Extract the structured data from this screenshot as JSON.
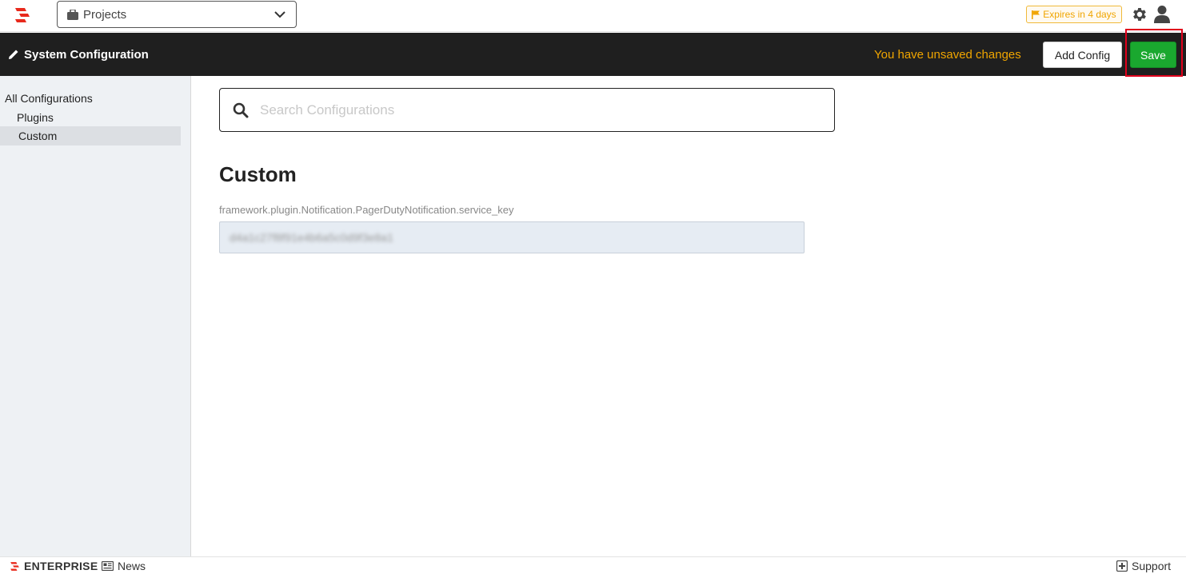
{
  "topbar": {
    "project_select_label": "Projects",
    "expires_badge": "Expires in 4 days",
    "colors": {
      "logo": "#e8291c",
      "badge": "#f0a500"
    }
  },
  "header": {
    "title": "System Configuration",
    "unsaved_text": "You have unsaved changes",
    "add_config_label": "Add Config",
    "save_label": "Save",
    "colors": {
      "background": "#1f1f1f",
      "save": "#1aa82f",
      "unsaved": "#f0a500"
    }
  },
  "sidebar": {
    "items": [
      {
        "label": "All Configurations"
      },
      {
        "label": "Plugins"
      },
      {
        "label": "Custom",
        "selected": true
      }
    ]
  },
  "main": {
    "search_placeholder": "Search Configurations",
    "section_title": "Custom",
    "fields": [
      {
        "label": "framework.plugin.Notification.PagerDutyNotification.service_key",
        "value": "d4a1c27f8f91e4b6a5c0d9f3e8a1"
      }
    ]
  },
  "footer": {
    "enterprise_label": "ENTERPRISE",
    "news_label": "News",
    "support_label": "Support"
  }
}
